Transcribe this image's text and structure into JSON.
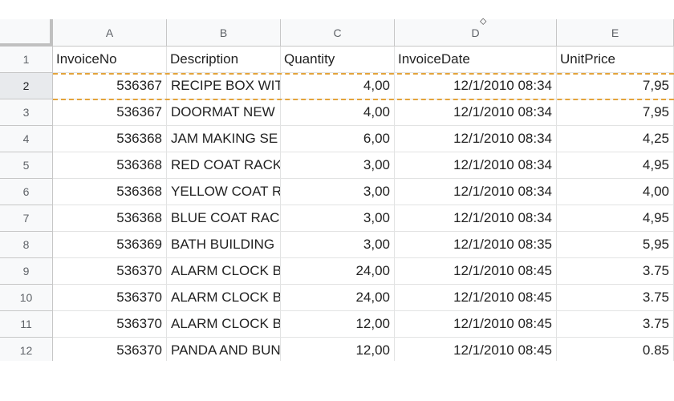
{
  "columns": [
    "A",
    "B",
    "C",
    "D",
    "E"
  ],
  "rows": [
    {
      "num": "1",
      "cells": [
        "InvoiceNo",
        "Description",
        "Quantity",
        "InvoiceDate",
        "UnitPrice"
      ]
    },
    {
      "num": "2",
      "cells": [
        "536367",
        "RECIPE BOX WIT",
        "4,00",
        "12/1/2010 08:34",
        "7,95"
      ]
    },
    {
      "num": "3",
      "cells": [
        "536367",
        "DOORMAT NEW",
        "4,00",
        "12/1/2010 08:34",
        "7,95"
      ]
    },
    {
      "num": "4",
      "cells": [
        "536368",
        "JAM MAKING SE",
        "6,00",
        "12/1/2010 08:34",
        "4,25"
      ]
    },
    {
      "num": "5",
      "cells": [
        "536368",
        "RED COAT RACK",
        "3,00",
        "12/1/2010 08:34",
        "4,95"
      ]
    },
    {
      "num": "6",
      "cells": [
        "536368",
        "YELLOW COAT RA",
        "3,00",
        "12/1/2010 08:34",
        "4,00"
      ]
    },
    {
      "num": "7",
      "cells": [
        "536368",
        "BLUE COAT RACK",
        "3,00",
        "12/1/2010 08:34",
        "4,95"
      ]
    },
    {
      "num": "8",
      "cells": [
        "536369",
        "BATH BUILDING",
        "3,00",
        "12/1/2010 08:35",
        "5,95"
      ]
    },
    {
      "num": "9",
      "cells": [
        "536370",
        "ALARM CLOCK B",
        "24,00",
        "12/1/2010 08:45",
        "3.75"
      ]
    },
    {
      "num": "10",
      "cells": [
        "536370",
        "ALARM CLOCK B",
        "24,00",
        "12/1/2010 08:45",
        "3.75"
      ]
    },
    {
      "num": "11",
      "cells": [
        "536370",
        "ALARM CLOCK B",
        "12,00",
        "12/1/2010 08:45",
        "3.75"
      ]
    },
    {
      "num": "12",
      "cells": [
        "536370",
        "PANDA AND BUN",
        "12,00",
        "12/1/2010 08:45",
        "0.85"
      ]
    }
  ],
  "selected_row": "2",
  "copy_marquee_color": "#e3a33b",
  "cursor_icon": "column-resize-cursor-icon"
}
